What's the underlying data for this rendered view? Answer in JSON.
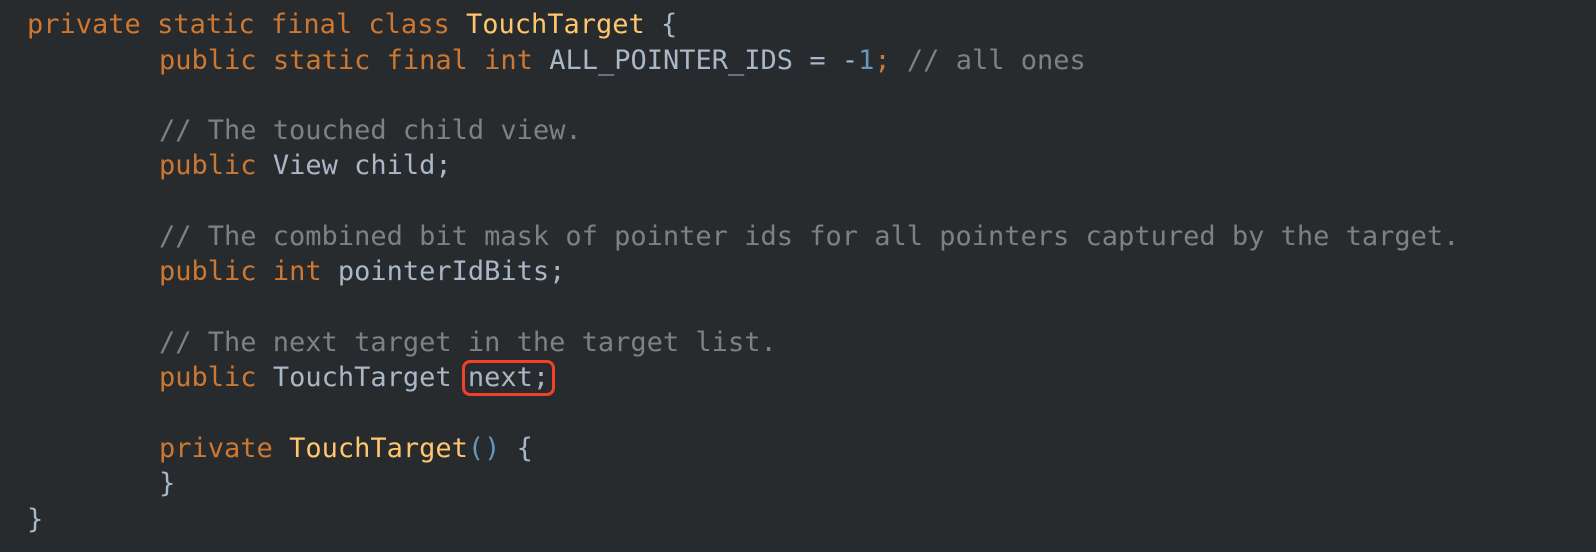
{
  "code": {
    "line1": {
      "kw1": "private",
      "kw2": "static",
      "kw3": "final",
      "kw4": "class",
      "class_name": "TouchTarget",
      "brace": "{"
    },
    "line2": {
      "kw1": "public",
      "kw2": "static",
      "kw3": "final",
      "kw4": "int",
      "const_name": "ALL_POINTER_IDS",
      "assign": "=",
      "minus": "-",
      "number": "1",
      "semi": ";",
      "comment": "// all ones"
    },
    "line3": {
      "comment": "// The touched child view."
    },
    "line4": {
      "kw1": "public",
      "type": "View",
      "field": "child;"
    },
    "line5": {
      "comment": "// The combined bit mask of pointer ids for all pointers captured by the target."
    },
    "line6": {
      "kw1": "public",
      "kw2": "int",
      "field": "pointerIdBits;"
    },
    "line7": {
      "comment": "// The next target in the target list."
    },
    "line8": {
      "kw1": "public",
      "type": "TouchTarget",
      "field": "next;"
    },
    "line9": {
      "kw1": "private",
      "method": "TouchTarget",
      "parens": "()",
      "brace": "{"
    },
    "line10": {
      "brace": "}"
    },
    "line11": {
      "brace": "}"
    }
  },
  "colors": {
    "background": "#282b2e",
    "keyword": "#cc7832",
    "class_name": "#ffc66d",
    "identifier": "#a9b7c6",
    "number": "#6897bb",
    "comment": "#808080",
    "highlight_border": "#f0412a"
  }
}
